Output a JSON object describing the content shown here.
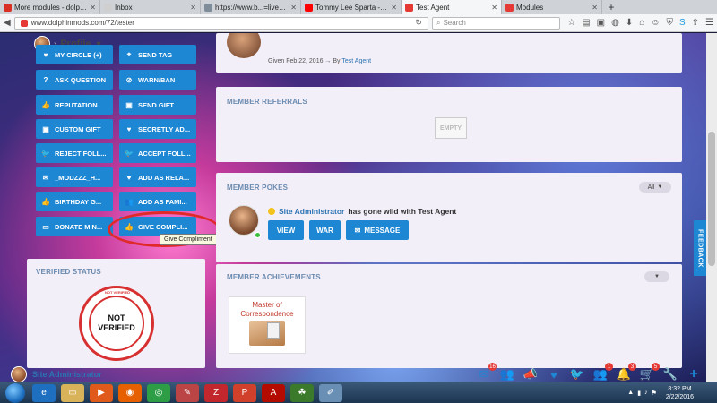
{
  "browser": {
    "tabs": [
      {
        "title": "More modules - dolphinm",
        "fav_color": "#d93025",
        "active": false
      },
      {
        "title": "Inbox",
        "fav_color": "#cfcfcf",
        "active": false
      },
      {
        "title": "https://www.b...=live_tracker",
        "fav_color": "#7f8c9a",
        "active": false
      },
      {
        "title": "Tommy Lee Sparta - M...",
        "fav_color": "#ff0000",
        "active": false
      },
      {
        "title": "Test Agent",
        "fav_color": "#e53935",
        "active": true
      },
      {
        "title": "Modules",
        "fav_color": "#e53935",
        "active": false
      }
    ],
    "url": "www.dolphinmods.com/72/tester",
    "search_placeholder": "Search"
  },
  "sidebar": {
    "profile_label": "Profile",
    "buttons": [
      {
        "label": "MY CIRCLE (+)",
        "icon": "heart-icon"
      },
      {
        "label": "SEND TAG",
        "icon": "tag-icon"
      },
      {
        "label": "ASK QUESTION",
        "icon": "question-icon"
      },
      {
        "label": "WARN/BAN",
        "icon": "ban-icon"
      },
      {
        "label": "REPUTATION",
        "icon": "thumbs-up-icon"
      },
      {
        "label": "SEND GIFT",
        "icon": "gift-icon"
      },
      {
        "label": "CUSTOM GIFT",
        "icon": "gift-icon"
      },
      {
        "label": "SECRETLY AD...",
        "icon": "heart-icon"
      },
      {
        "label": "REJECT FOLL...",
        "icon": "twitter-icon"
      },
      {
        "label": "ACCEPT FOLL...",
        "icon": "twitter-icon"
      },
      {
        "label": "_MODZZZ_H...",
        "icon": "envelope-icon"
      },
      {
        "label": "ADD AS RELA...",
        "icon": "heart-icon"
      },
      {
        "label": "BIRTHDAY G...",
        "icon": "thumbs-up-icon"
      },
      {
        "label": "ADD AS FAMI...",
        "icon": "group-icon"
      },
      {
        "label": "DONATE MIN...",
        "icon": "cash-icon"
      },
      {
        "label": "GIVE COMPLI...",
        "icon": "thumbs-up-icon"
      }
    ],
    "tooltip": "Give Compliment",
    "verified_title": "VERIFIED STATUS",
    "seal_line1": "NOT",
    "seal_line2": "VERIFIED",
    "seal_ring": "NOT VERIFIED"
  },
  "main": {
    "given_text": "Given Feb 22, 2016 → By",
    "given_by": "Test Agent",
    "referrals_title": "MEMBER REFERRALS",
    "empty_label": "EMPTY",
    "pokes_title": "MEMBER POKES",
    "pokes_filter": "All",
    "poke_user": "Site Administrator",
    "poke_text": "has gone wild with Test Agent",
    "poke_buttons": {
      "view": "VIEW",
      "war": "WAR",
      "message": "MESSAGE"
    },
    "achievements_title": "MEMBER ACHIEVEMENTS",
    "achievement_name": "Master of Correspondence"
  },
  "footer": {
    "user_name": "Site Administrator",
    "icons": [
      {
        "name": "mail-icon",
        "badge": "16"
      },
      {
        "name": "group-icon",
        "badge": ""
      },
      {
        "name": "megaphone-icon",
        "badge": ""
      },
      {
        "name": "heart-icon",
        "badge": ""
      },
      {
        "name": "twitter-icon",
        "badge": ""
      },
      {
        "name": "friends-icon",
        "badge": "1"
      },
      {
        "name": "bell-icon",
        "badge": "3"
      },
      {
        "name": "cart-icon",
        "badge": "5"
      },
      {
        "name": "wrench-icon",
        "badge": ""
      },
      {
        "name": "plus-icon",
        "badge": ""
      }
    ]
  },
  "feedback_label": "FEEDBACK",
  "taskbar": {
    "time": "8:32 PM",
    "date": "2/22/2016"
  },
  "colors": {
    "accent": "#1d87d4",
    "panel": "#f3eff8",
    "highlight": "#e02a2a"
  }
}
